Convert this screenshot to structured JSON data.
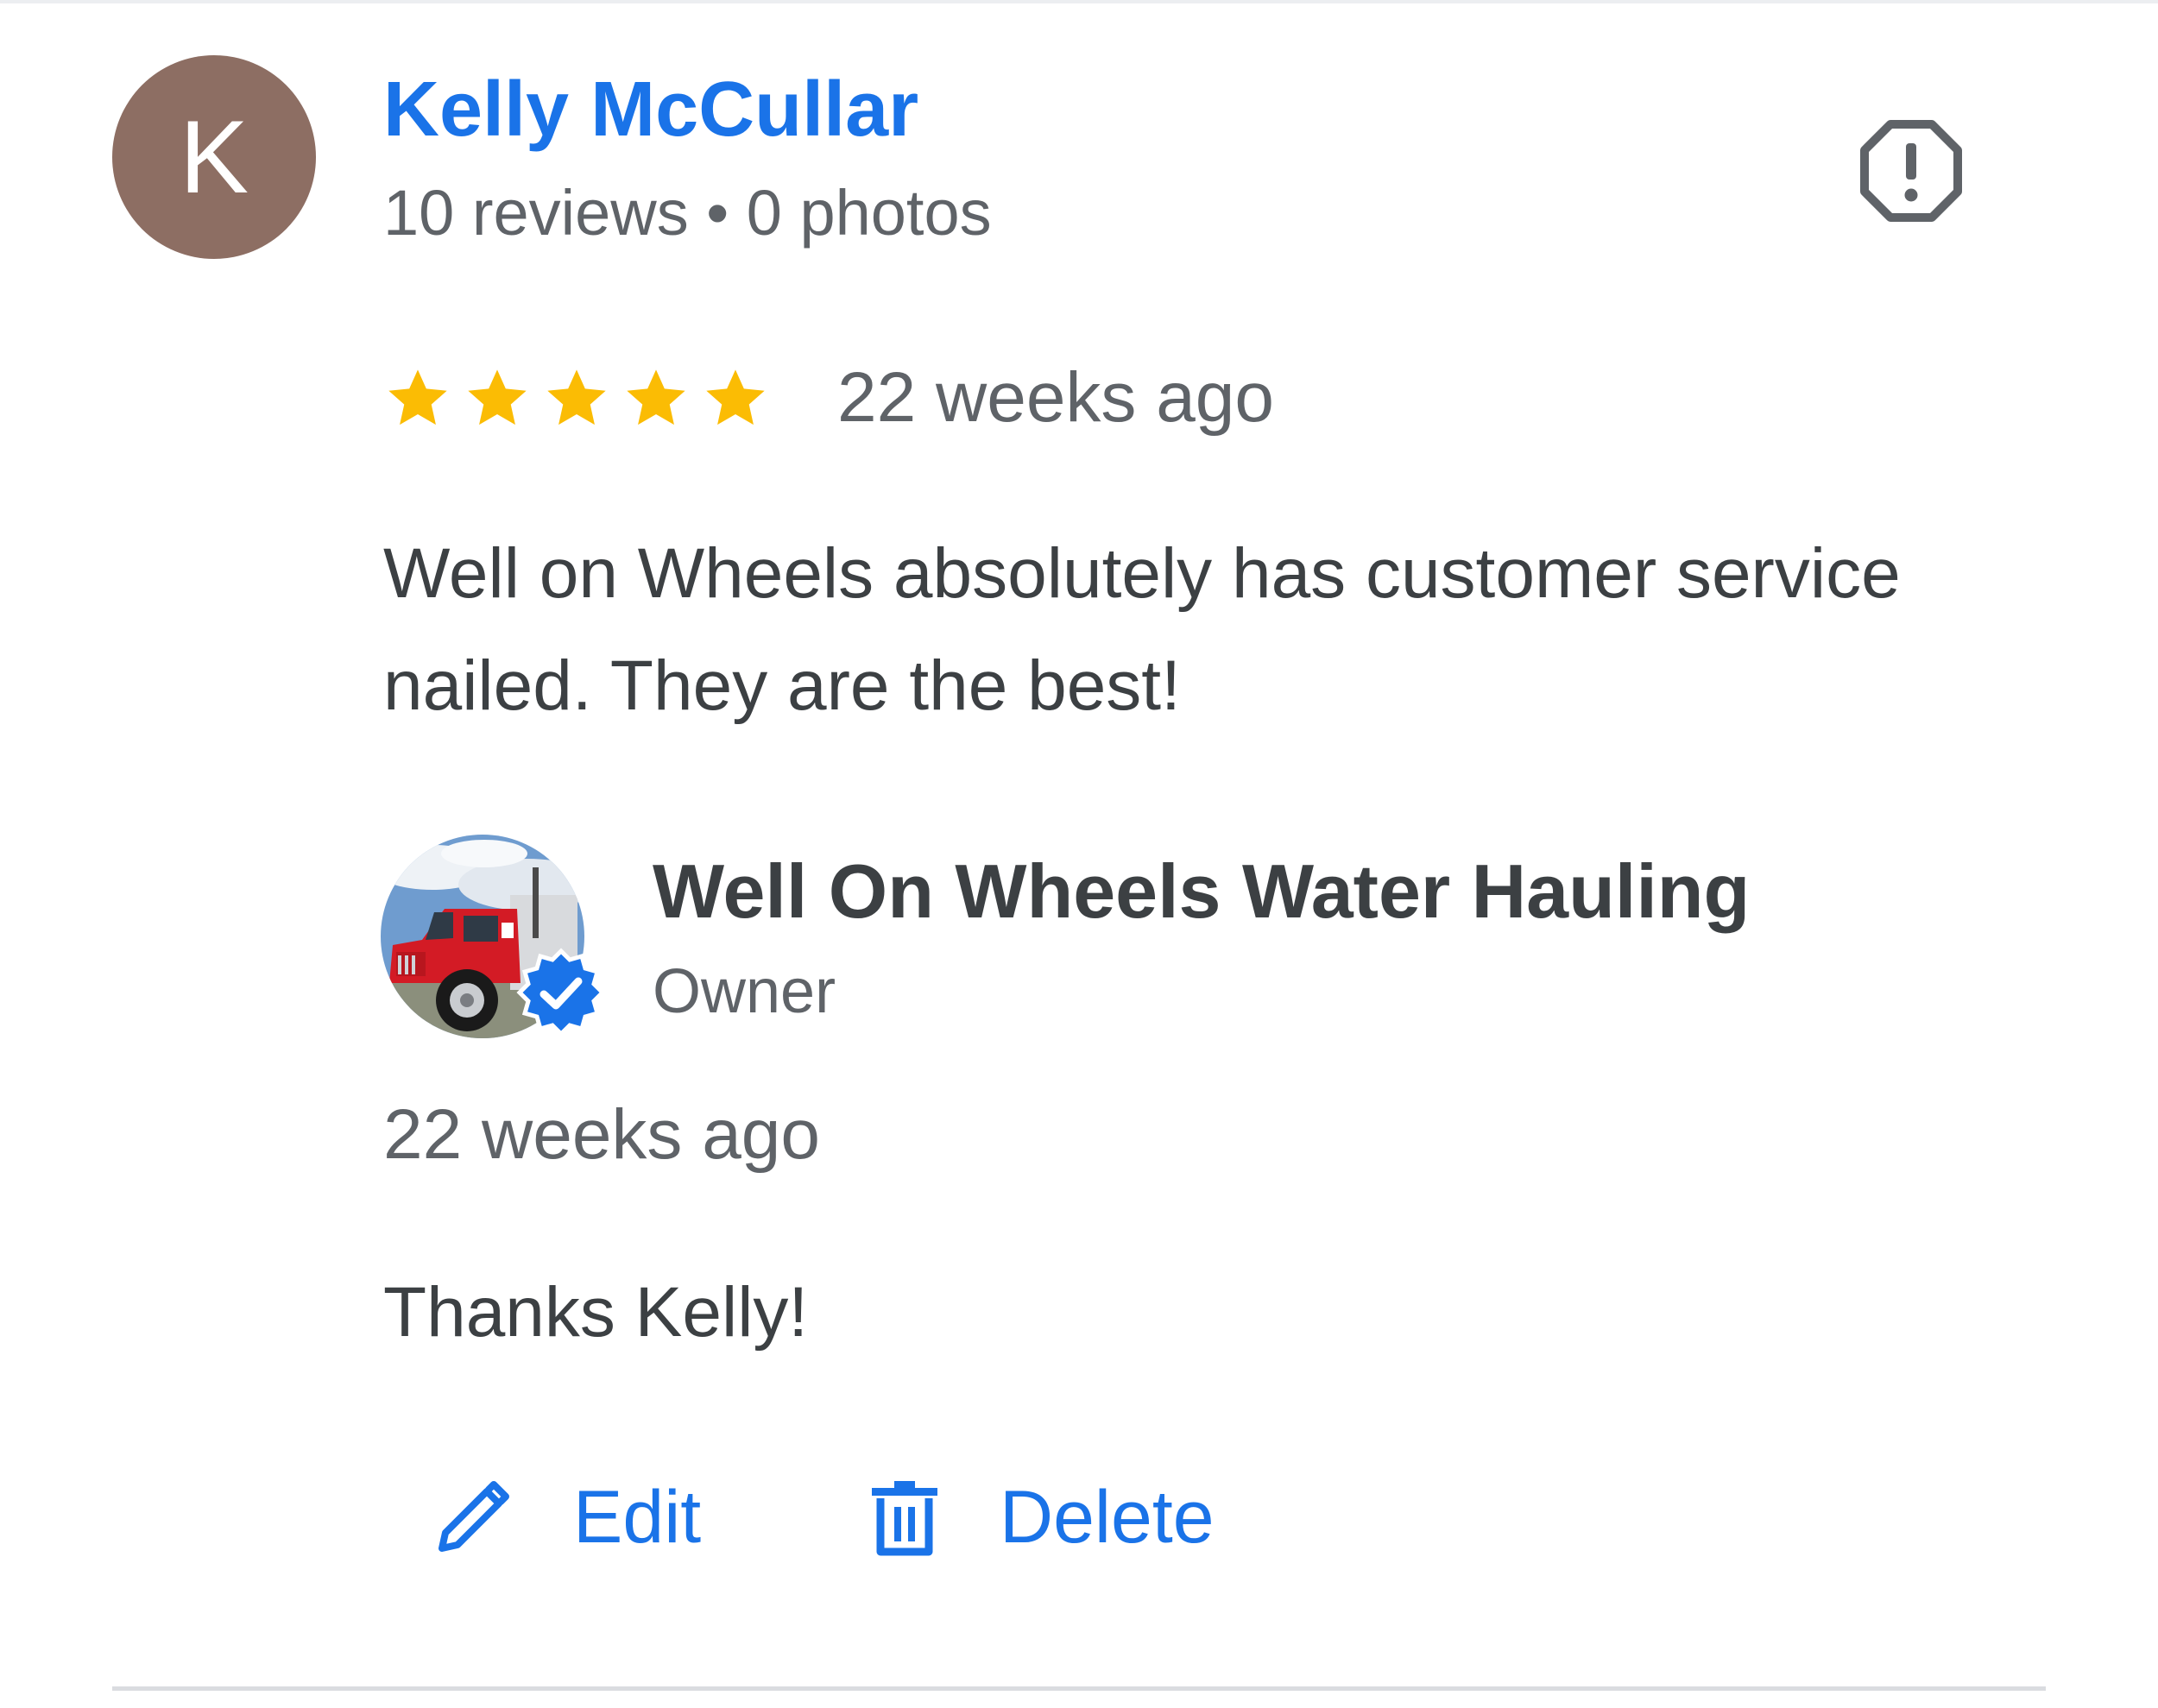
{
  "review": {
    "avatar_letter": "K",
    "avatar_color": "#8d6e63",
    "author": "Kelly McCullar",
    "meta": "10 reviews • 0 photos",
    "rating": 5,
    "rating_max": 5,
    "date": "22 weeks ago",
    "text": "Well on Wheels absolutely has customer service nailed. They are the best!",
    "report_icon": "report-flag-icon"
  },
  "reply": {
    "owner_name": "Well On Wheels Water Hauling",
    "role": "Owner",
    "verified_icon": "verified-badge-icon",
    "date": "22 weeks ago",
    "text": "Thanks Kelly!"
  },
  "actions": {
    "edit_label": "Edit",
    "edit_icon": "pencil-icon",
    "delete_label": "Delete",
    "delete_icon": "trash-icon"
  },
  "colors": {
    "link_blue": "#1a73e8",
    "star_gold": "#fbbc04",
    "text_primary": "#3c4043",
    "text_secondary": "#5f6368"
  }
}
